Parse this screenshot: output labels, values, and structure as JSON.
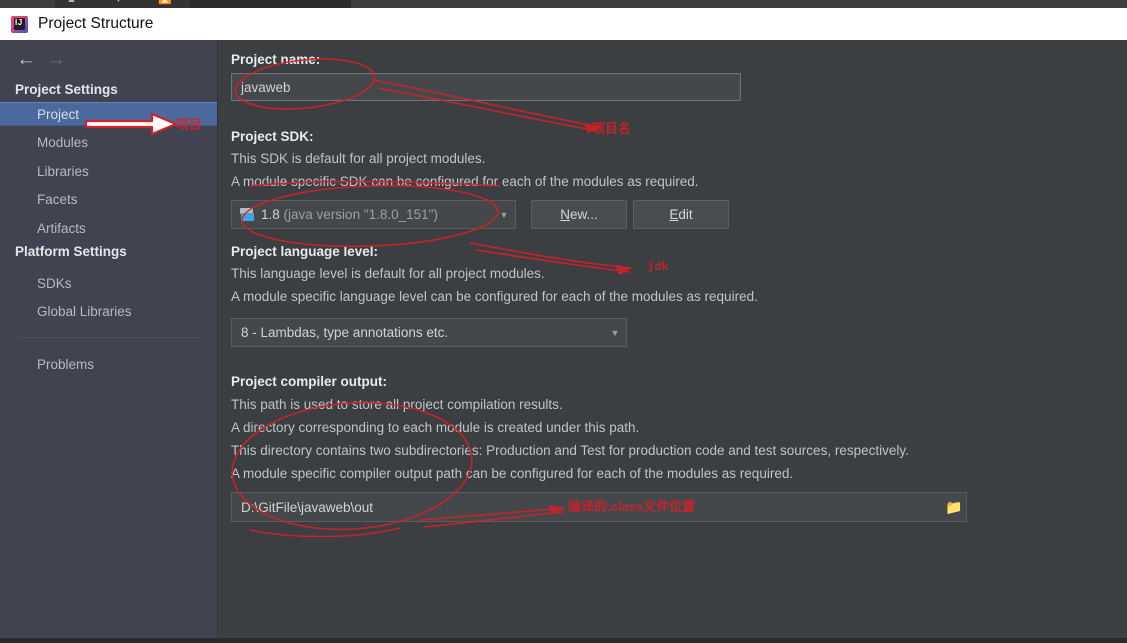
{
  "window": {
    "title": "Project Structure",
    "icon": "intellij-idea-icon"
  },
  "nav": {
    "back_icon": "arrow-left-icon",
    "forward_icon": "arrow-right-icon"
  },
  "sidebar": {
    "sections": [
      {
        "heading": "Project Settings",
        "items": [
          {
            "label": "Project",
            "selected": true
          },
          {
            "label": "Modules",
            "selected": false
          },
          {
            "label": "Libraries",
            "selected": false
          },
          {
            "label": "Facets",
            "selected": false
          },
          {
            "label": "Artifacts",
            "selected": false
          }
        ]
      },
      {
        "heading": "Platform Settings",
        "items": [
          {
            "label": "SDKs",
            "selected": false
          },
          {
            "label": "Global Libraries",
            "selected": false
          }
        ]
      }
    ],
    "extra_items": [
      {
        "label": "Problems",
        "selected": false
      }
    ]
  },
  "main": {
    "project_name": {
      "label": "Project name:",
      "value": "javaweb",
      "placeholder": ""
    },
    "project_sdk": {
      "label": "Project SDK:",
      "desc1": "This SDK is default for all project modules.",
      "desc2": "A module specific SDK can be configured for each of the modules as required.",
      "value_main": "1.8",
      "value_detail": "(java version \"1.8.0_151\")",
      "dropdown_icon": "chevron-down-icon",
      "sdk_icon": "jdk-folder-icon",
      "new_button": "New...",
      "new_button_mnemonic": "N",
      "edit_button": "Edit",
      "edit_button_mnemonic": "E"
    },
    "language_level": {
      "label": "Project language level:",
      "desc1": "This language level is default for all project modules.",
      "desc2": "A module specific language level can be configured for each of the modules as required.",
      "value": "8 - Lambdas, type annotations etc.",
      "dropdown_icon": "chevron-down-icon"
    },
    "compiler_output": {
      "label": "Project compiler output:",
      "desc1": "This path is used to store all project compilation results.",
      "desc2": "A directory corresponding to each module is created under this path.",
      "desc3": "This directory contains two subdirectories: Production and Test for production code and test sources, respectively.",
      "desc4": "A module specific compiler output path can be configured for each of the modules as required.",
      "value": "D:\\GitFile\\javaweb\\out",
      "browse_icon": "folder-browse-icon"
    }
  },
  "annotations": {
    "color": "#d6202a",
    "items": [
      {
        "name": "project-annotation",
        "text": "项目"
      },
      {
        "name": "project-name-annotation",
        "text": "项目名"
      },
      {
        "name": "jdk-annotation",
        "text": "jdk"
      },
      {
        "name": "compiler-output-annotation",
        "text": "编译的.class文件位置"
      }
    ]
  }
}
